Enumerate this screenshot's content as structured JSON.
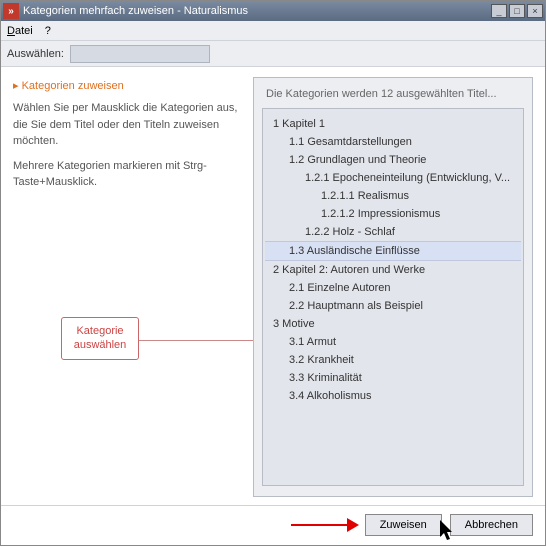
{
  "window": {
    "title": "Kategorien mehrfach zuweisen - Naturalismus",
    "icon_glyph": "»"
  },
  "menu": {
    "file": "Datei",
    "help": "?"
  },
  "selectbar": {
    "label": "Auswählen:",
    "value": ""
  },
  "sidebar": {
    "heading": "Kategorien zuweisen",
    "para1": "Wählen Sie per Mausklick die Kategorien aus, die Sie dem Titel oder den Titeln zuweisen möchten.",
    "para2": "Mehrere Kategorien markieren mit Strg-Taste+Mausklick."
  },
  "callout": {
    "line1": "Kategorie",
    "line2": "auswählen"
  },
  "groupbox": {
    "title": "Die Kategorien werden 12 ausgewählten Titel..."
  },
  "tree": {
    "items": [
      {
        "level": 0,
        "label": "1 Kapitel 1",
        "selected": false
      },
      {
        "level": 1,
        "label": "1.1 Gesamtdarstellungen",
        "selected": false
      },
      {
        "level": 1,
        "label": "1.2 Grundlagen und Theorie",
        "selected": false
      },
      {
        "level": 2,
        "label": "1.2.1 Epocheneinteilung (Entwicklung, V...",
        "selected": false
      },
      {
        "level": 3,
        "label": "1.2.1.1 Realismus",
        "selected": false
      },
      {
        "level": 3,
        "label": "1.2.1.2 Impressionismus",
        "selected": false
      },
      {
        "level": 2,
        "label": "1.2.2 Holz - Schlaf",
        "selected": false
      },
      {
        "level": 1,
        "label": "1.3 Ausländische Einflüsse",
        "selected": true
      },
      {
        "level": 0,
        "label": "2 Kapitel 2: Autoren und Werke",
        "selected": false
      },
      {
        "level": 1,
        "label": "2.1 Einzelne Autoren",
        "selected": false
      },
      {
        "level": 1,
        "label": "2.2 Hauptmann als Beispiel",
        "selected": false
      },
      {
        "level": 0,
        "label": "3 Motive",
        "selected": false
      },
      {
        "level": 1,
        "label": "3.1 Armut",
        "selected": false
      },
      {
        "level": 1,
        "label": "3.2 Krankheit",
        "selected": false
      },
      {
        "level": 1,
        "label": "3.3 Kriminalität",
        "selected": false
      },
      {
        "level": 1,
        "label": "3.4 Alkoholismus",
        "selected": false
      }
    ]
  },
  "buttons": {
    "assign": "Zuweisen",
    "cancel": "Abbrechen"
  },
  "colors": {
    "accent": "#e07020",
    "callout_border": "#cc6666",
    "arrow": "#e00000",
    "selection_bg": "#d8e0f4"
  }
}
